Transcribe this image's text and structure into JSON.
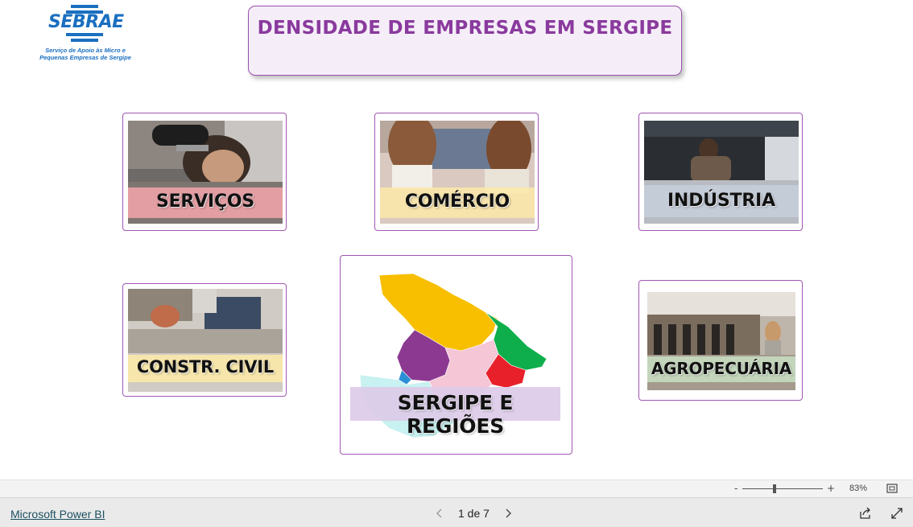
{
  "logo": {
    "name": "SEBRAE",
    "subtitle_line1": "Serviço de Apoio às Micro e",
    "subtitle_line2": "Pequenas Empresas de Sergipe"
  },
  "title": "DENSIDADE DE EMPRESAS EM SERGIPE",
  "cards": {
    "servicos": {
      "label": "SERVIÇOS"
    },
    "comercio": {
      "label": "COMÉRCIO"
    },
    "industria": {
      "label": "INDÚSTRIA"
    },
    "construcao": {
      "label": "CONSTR. CIVIL"
    },
    "regioes": {
      "label": "SERGIPE E REGIÕES"
    },
    "agropecuaria": {
      "label": "AGROPECUÁRIA"
    }
  },
  "zoom": {
    "minus": "-",
    "plus": "+",
    "level": "83%"
  },
  "footer": {
    "powerbi_link": "Microsoft Power BI",
    "page_indicator": "1 de 7"
  },
  "colors": {
    "accent_purple": "#9b4fb0",
    "title_purple": "#8a3a9e",
    "servicos_band": "#f4a6ab",
    "comercio_band": "#fbe9a8",
    "industria_band": "#c5cdda",
    "construcao_band": "#fbe9a8",
    "regioes_band": "#dccbe8",
    "agropecuaria_band": "#c7dcc0"
  },
  "icons": [
    "sebrae-logo",
    "chevron-left-icon",
    "chevron-right-icon",
    "fit-page-icon",
    "share-icon",
    "fullscreen-icon"
  ]
}
